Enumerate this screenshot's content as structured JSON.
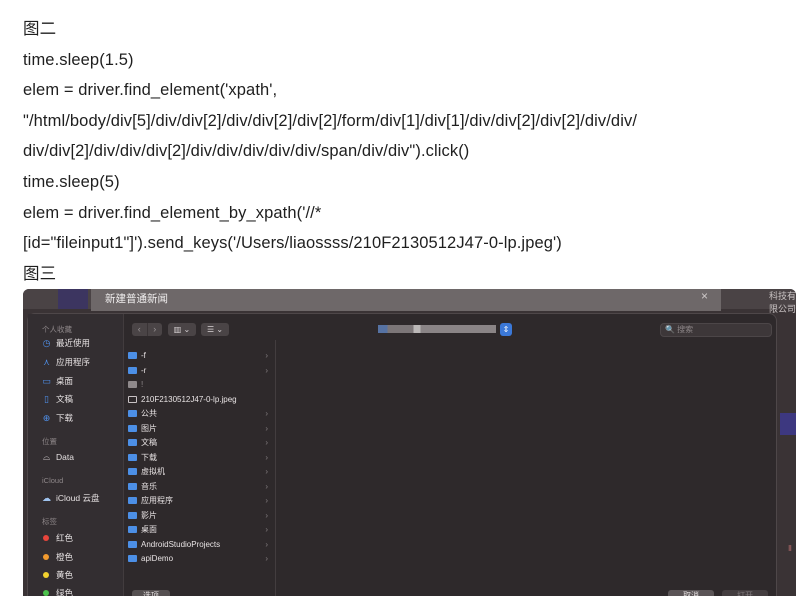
{
  "article": {
    "lines": [
      "图二",
      "time.sleep(1.5)",
      "elem = driver.find_element('xpath',",
      "\"/html/body/div[5]/div/div[2]/div/div[2]/div[2]/form/div[1]/div[1]/div/div[2]/div[2]/div/div/",
      "div/div[2]/div/div/div[2]/div/div/div/div/div/span/div/div\").click()",
      "time.sleep(5)",
      "elem = driver.find_element_by_xpath('//*",
      "[id=\"fileinput1\"]').send_keys('/Users/liaossss/210F2130512J47-0-lp.jpeg')",
      "图三"
    ]
  },
  "screenshot": {
    "background_dialog_title": "新建普通新闻",
    "background_close": "×",
    "background_right_text": "科技有限公司",
    "background_red_text": "Ⅱ",
    "sidebar": {
      "sections": [
        {
          "title": "个人收藏",
          "items": [
            {
              "label": "最近使用",
              "icon": "clock-icon",
              "glyph": "◷"
            },
            {
              "label": "应用程序",
              "icon": "apps-icon",
              "glyph": "⋏"
            },
            {
              "label": "桌面",
              "icon": "desktop-icon",
              "glyph": "▭"
            },
            {
              "label": "文稿",
              "icon": "document-icon",
              "glyph": "▯"
            },
            {
              "label": "下载",
              "icon": "download-icon",
              "glyph": "⊕"
            }
          ]
        },
        {
          "title": "位置",
          "items": [
            {
              "label": "Data",
              "icon": "drive-icon",
              "glyph": "⌓"
            }
          ]
        },
        {
          "title": "iCloud",
          "items": [
            {
              "label": "iCloud 云盘",
              "icon": "cloud-icon",
              "glyph": "☁"
            }
          ]
        },
        {
          "title": "标签",
          "items": [
            {
              "label": "红色",
              "icon": "tag-red-icon",
              "color": "#e8453c"
            },
            {
              "label": "橙色",
              "icon": "tag-orange-icon",
              "color": "#f29a2e"
            },
            {
              "label": "黄色",
              "icon": "tag-yellow-icon",
              "color": "#f2d12e"
            },
            {
              "label": "绿色",
              "icon": "tag-green-icon",
              "color": "#4cc24c"
            }
          ]
        }
      ]
    },
    "toolbar": {
      "back": "‹",
      "forward": "›",
      "column_view": "▥ ⌄",
      "list_view": "☰ ⌄",
      "path_stepper": "⇕",
      "search_placeholder": "🔍 搜索"
    },
    "files": [
      {
        "name": "-f",
        "kind": "folder",
        "chevron": "›"
      },
      {
        "name": "-r",
        "kind": "folder",
        "chevron": "›"
      },
      {
        "name": "!",
        "kind": "gray",
        "chevron": ""
      },
      {
        "name": "210F2130512J47-0-lp.jpeg",
        "kind": "file",
        "chevron": ""
      },
      {
        "name": "公共",
        "kind": "folder",
        "chevron": "›"
      },
      {
        "name": "图片",
        "kind": "folder",
        "chevron": "›"
      },
      {
        "name": "文稿",
        "kind": "folder",
        "chevron": "›"
      },
      {
        "name": "下载",
        "kind": "folder",
        "chevron": "›"
      },
      {
        "name": "虚拟机",
        "kind": "folder",
        "chevron": "›"
      },
      {
        "name": "音乐",
        "kind": "folder",
        "chevron": "›"
      },
      {
        "name": "应用程序",
        "kind": "folder",
        "chevron": "›"
      },
      {
        "name": "影片",
        "kind": "folder",
        "chevron": "›"
      },
      {
        "name": "桌面",
        "kind": "folder",
        "chevron": "›"
      },
      {
        "name": "AndroidStudioProjects",
        "kind": "folder",
        "chevron": "›"
      },
      {
        "name": "apiDemo",
        "kind": "folder",
        "chevron": "›"
      }
    ],
    "buttons": {
      "options": "选项",
      "cancel": "取消",
      "open": "打开"
    }
  }
}
